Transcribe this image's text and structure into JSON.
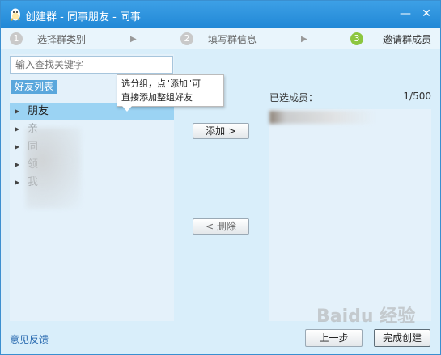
{
  "window": {
    "title": "创建群 - 同事朋友 - 同事",
    "minimize_glyph": "—",
    "close_glyph": "✕"
  },
  "steps": [
    {
      "num": "1",
      "label": "选择群类别"
    },
    {
      "num": "2",
      "label": "填写群信息"
    },
    {
      "num": "3",
      "label": "邀请群成员"
    }
  ],
  "search": {
    "placeholder": "输入查找关键字"
  },
  "friends_tab": {
    "label": "好友列表"
  },
  "groups": [
    {
      "label": "朋友"
    },
    {
      "label": "亲"
    },
    {
      "label": "同"
    },
    {
      "label": "领"
    },
    {
      "label": "我"
    }
  ],
  "tooltip": {
    "line1": "选分组，点\"添加\"可",
    "line2": "直接添加整组好友"
  },
  "actions": {
    "add_label": "添加 >",
    "delete_label": "< 删除"
  },
  "selected": {
    "label": "已选成员：",
    "count": "1/500"
  },
  "footer": {
    "feedback_label": "意见反馈",
    "prev_label": "上一步",
    "finish_label": "完成创建"
  },
  "watermark": {
    "text": "Baidu 经验"
  }
}
